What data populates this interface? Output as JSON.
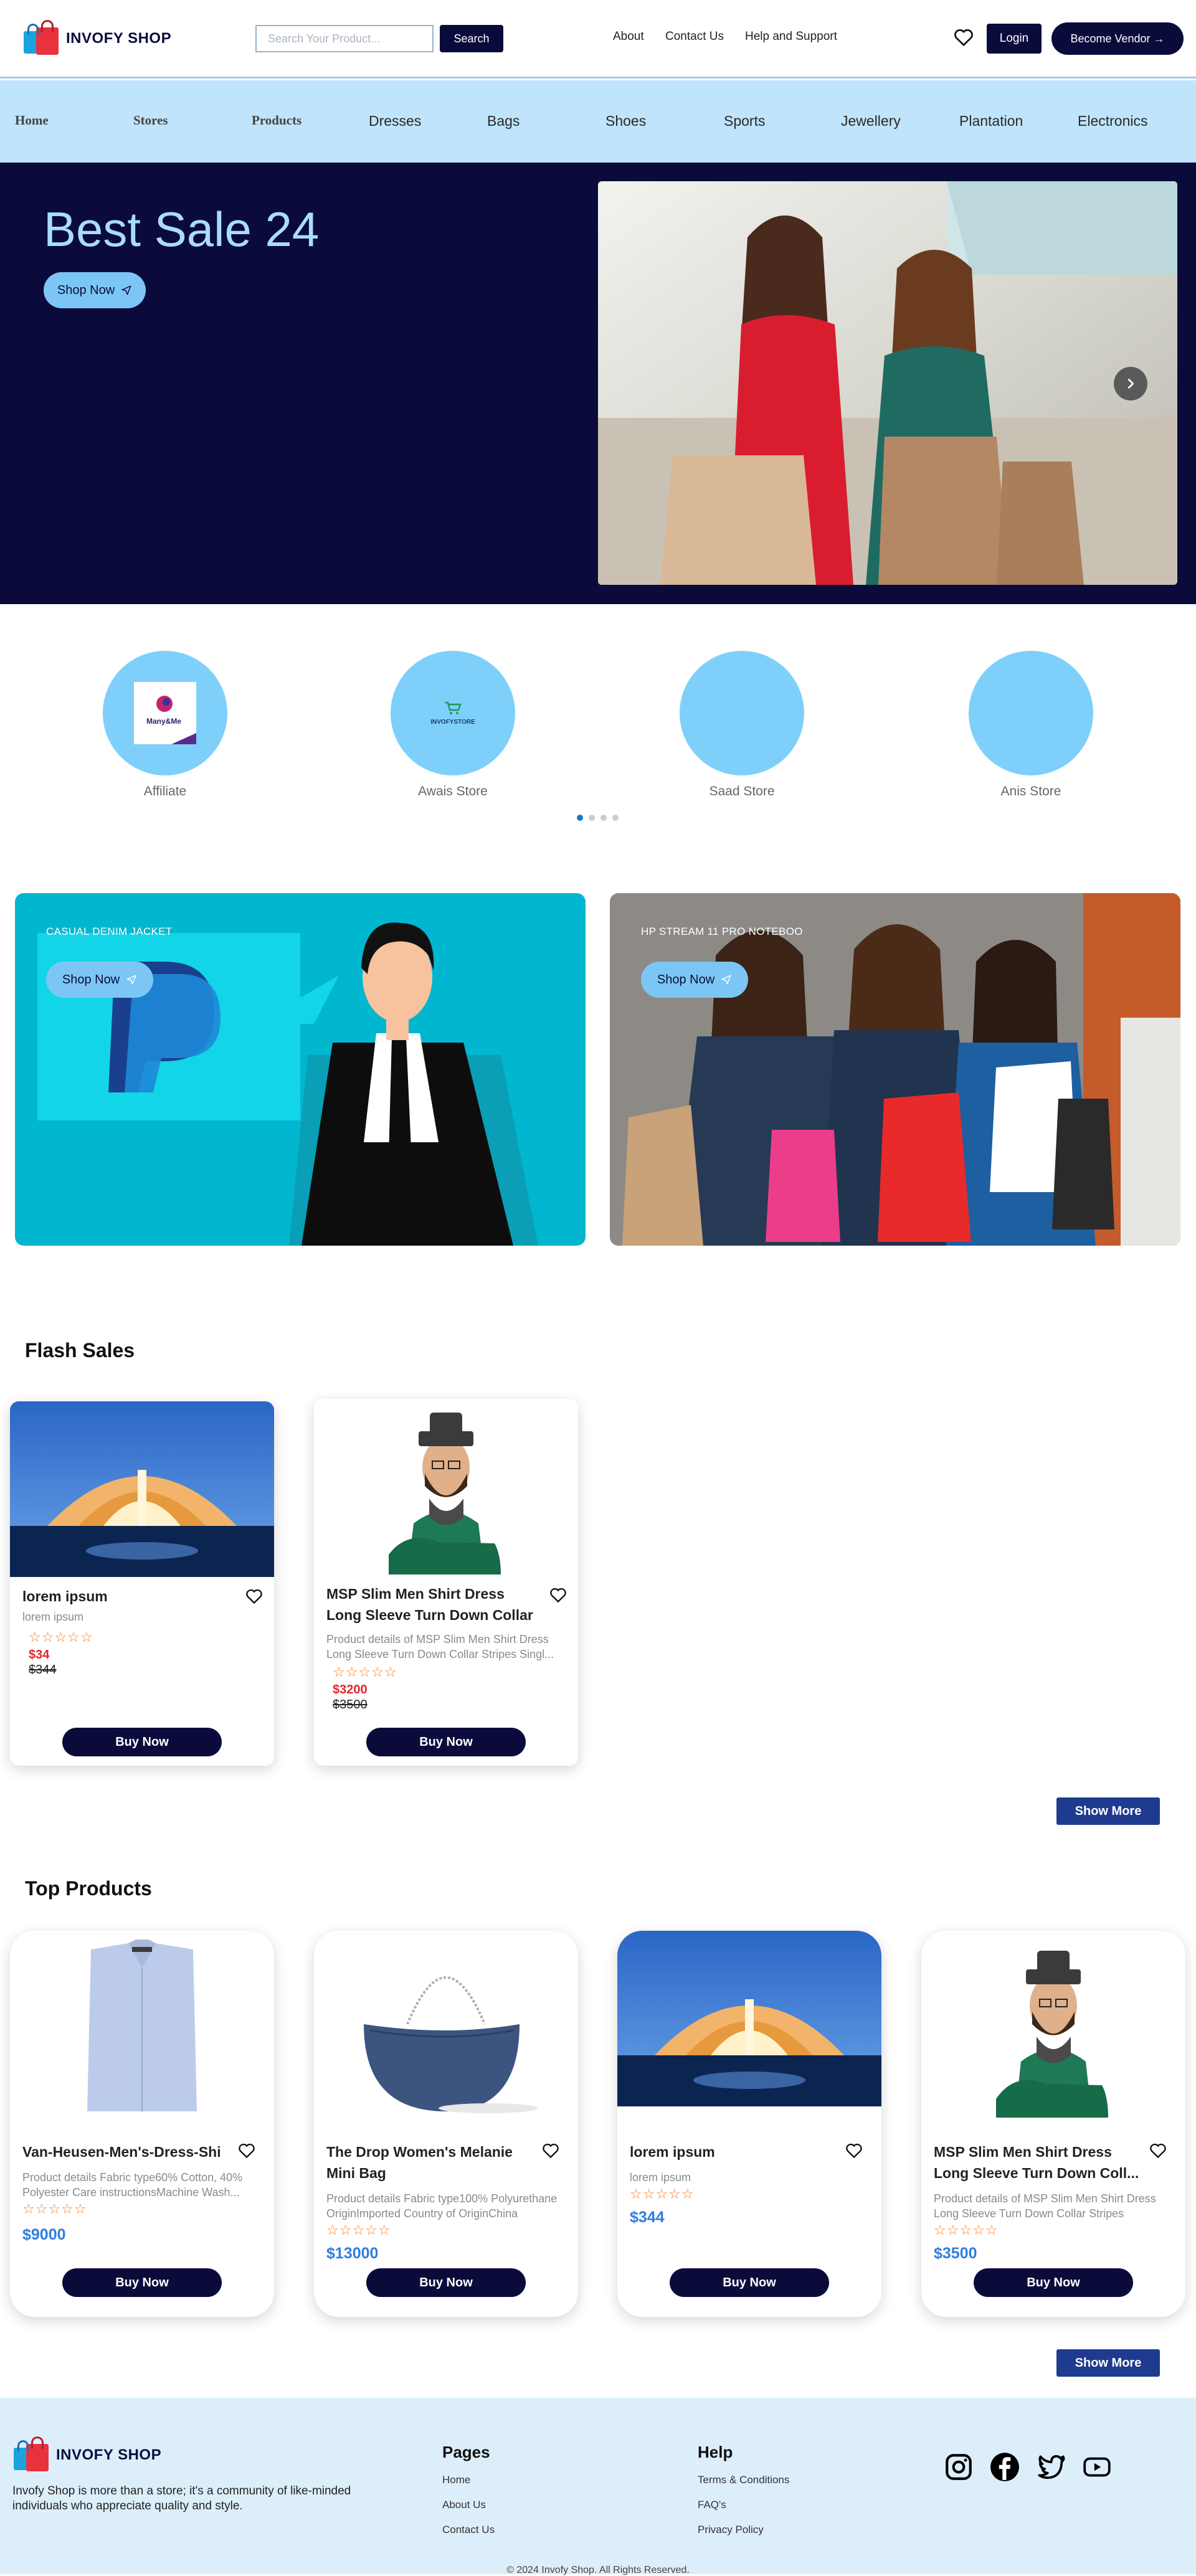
{
  "brand": {
    "name": "INVOFY SHOP"
  },
  "header": {
    "search_placeholder": "Search Your Product...",
    "search_button": "Search",
    "links": [
      "About",
      "Contact Us",
      "Help and Support"
    ],
    "login": "Login",
    "vendor": "Become Vendor →"
  },
  "nav": [
    "Home",
    "Stores",
    "Products",
    "Dresses",
    "Bags",
    "Shoes",
    "Sports",
    "Jewellery",
    "Plantation",
    "Electronics"
  ],
  "hero": {
    "title": "Best Sale 24",
    "shop_now": "Shop Now",
    "next_icon": "chevron-right-icon"
  },
  "stores": [
    {
      "label": "Affiliate",
      "logo_text": "Many&Me"
    },
    {
      "label": "Awais Store",
      "logo_text": "INVOFYSTORE"
    },
    {
      "label": "Saad Store"
    },
    {
      "label": "Anis Store"
    }
  ],
  "promos": [
    {
      "label": "CASUAL DENIM JACKET",
      "shop_now": "Shop Now"
    },
    {
      "label": "HP STREAM 11 PRO NOTEBOO",
      "shop_now": "Shop Now"
    }
  ],
  "flash_sales": {
    "title": "Flash Sales",
    "items": [
      {
        "title": "lorem ipsum",
        "desc": "lorem ipsum",
        "rating": "☆☆☆☆☆",
        "price": "$34",
        "old_price": "$344",
        "buy": "Buy Now"
      },
      {
        "title": "MSP Slim Men Shirt Dress Long Sleeve Turn Down Collar Stripe...",
        "desc": "Product details of MSP Slim Men Shirt Dress Long Sleeve Turn Down Collar Stripes Singl...",
        "rating": "☆☆☆☆☆",
        "price": "$3200",
        "old_price": "$3500",
        "buy": "Buy Now"
      }
    ],
    "show_more": "Show More"
  },
  "top_products": {
    "title": "Top Products",
    "items": [
      {
        "title": "Van-Heusen-Men's-Dress-Shir",
        "desc": "Product details Fabric type60% Cotton, 40% Polyester Care instructionsMachine Wash...",
        "rating": "☆☆☆☆☆",
        "price": "$9000",
        "buy": "Buy Now"
      },
      {
        "title": "The Drop Women's Melanie Mini Bag",
        "desc": "Product details Fabric type100% Polyurethane OriginImported Country of OriginChina",
        "rating": "☆☆☆☆☆",
        "price": "$13000",
        "buy": "Buy Now"
      },
      {
        "title": "lorem ipsum",
        "desc": "lorem ipsum",
        "rating": "☆☆☆☆☆",
        "price": "$344",
        "buy": "Buy Now"
      },
      {
        "title": "MSP Slim Men Shirt Dress Long Sleeve Turn Down Coll...",
        "desc": "Product details of MSP Slim Men Shirt Dress Long Sleeve Turn Down Collar Stripes Single-...",
        "rating": "☆☆☆☆☆",
        "price": "$3500",
        "buy": "Buy Now"
      }
    ],
    "show_more": "Show More"
  },
  "footer": {
    "about": "Invofy Shop is more than a store; it's a community of like-minded individuals who appreciate quality and style.",
    "pages_title": "Pages",
    "pages": [
      "Home",
      "About Us",
      "Contact Us"
    ],
    "help_title": "Help",
    "help": [
      "Terms & Conditions",
      "FAQ's",
      "Privacy Policy"
    ],
    "social": [
      "instagram-icon",
      "facebook-icon",
      "twitter-icon",
      "youtube-icon"
    ],
    "copyright": "© 2024 Invofy Shop. All Rights Reserved."
  },
  "colors": {
    "navy": "#0b0b3b",
    "sky": "#bfe4fb",
    "accent": "#7cc6f5",
    "price_blue": "#2f7ee0",
    "price_red": "#e2262b",
    "star": "#ff7a1a"
  }
}
